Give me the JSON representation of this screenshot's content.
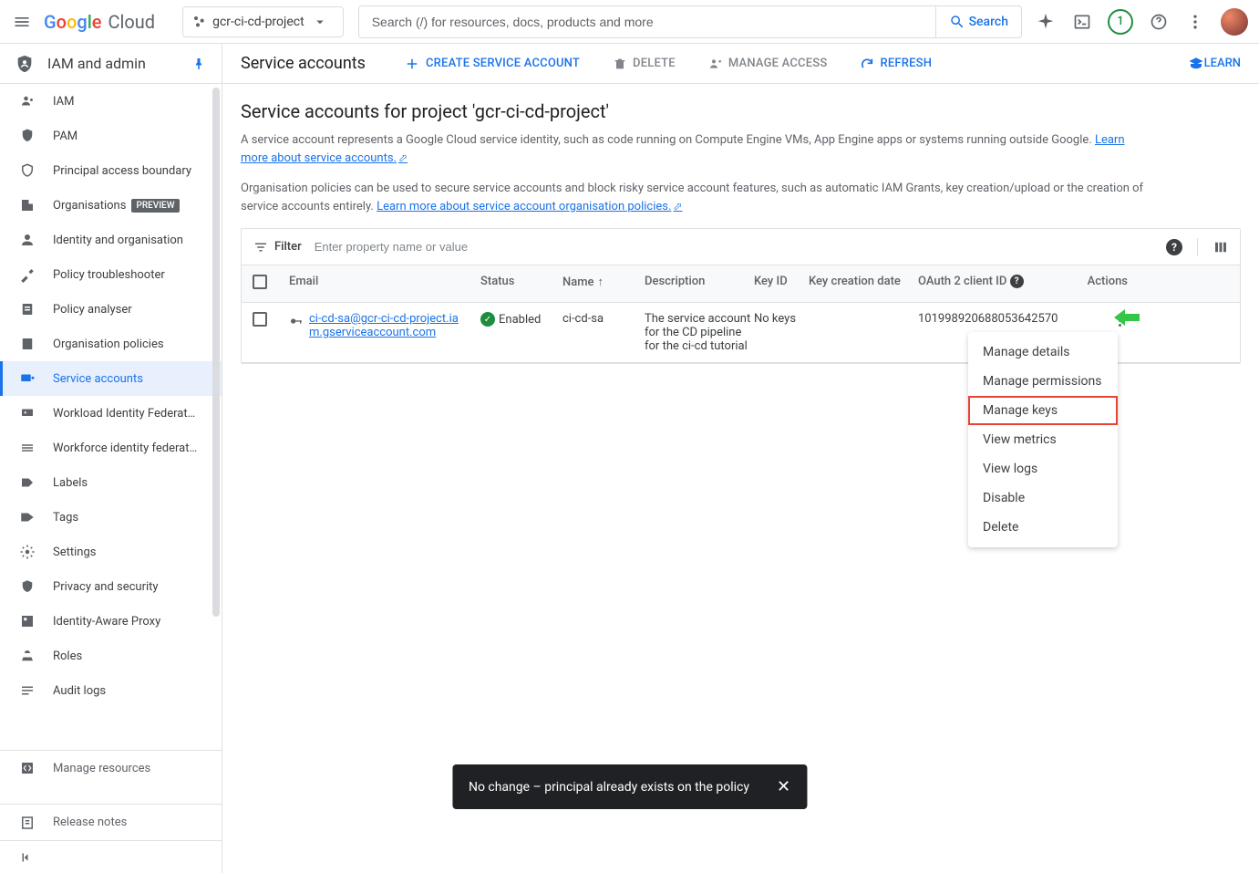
{
  "header": {
    "project_name": "gcr-ci-cd-project",
    "search_placeholder": "Search (/) for resources, docs, products and more",
    "search_button": "Search",
    "badge_count": "1"
  },
  "sidebar": {
    "section_title": "IAM and admin",
    "items": [
      {
        "label": "IAM"
      },
      {
        "label": "PAM"
      },
      {
        "label": "Principal access boundary"
      },
      {
        "label": "Organisations",
        "badge": "PREVIEW"
      },
      {
        "label": "Identity and organisation"
      },
      {
        "label": "Policy troubleshooter"
      },
      {
        "label": "Policy analyser"
      },
      {
        "label": "Organisation policies"
      },
      {
        "label": "Service accounts"
      },
      {
        "label": "Workload Identity Federat…"
      },
      {
        "label": "Workforce identity federat…"
      },
      {
        "label": "Labels"
      },
      {
        "label": "Tags"
      },
      {
        "label": "Settings"
      },
      {
        "label": "Privacy and security"
      },
      {
        "label": "Identity-Aware Proxy"
      },
      {
        "label": "Roles"
      },
      {
        "label": "Audit logs"
      }
    ],
    "bottom": {
      "label": "Manage resources"
    },
    "release_notes": "Release notes"
  },
  "page": {
    "title": "Service accounts",
    "actions": {
      "create": "Create service account",
      "delete": "Delete",
      "manage_access": "Manage access",
      "refresh": "Refresh",
      "learn": "Learn"
    },
    "heading": "Service accounts for project 'gcr-ci-cd-project'",
    "desc1a": "A service account represents a Google Cloud service identity, such as code running on Compute Engine VMs, App Engine apps or systems running outside Google. ",
    "desc1_link": "Learn more about service accounts.",
    "desc2a": "Organisation policies can be used to secure service accounts and block risky service account features, such as automatic IAM Grants, key creation/upload or the creation of service accounts entirely. ",
    "desc2_link": "Learn more about service account organisation policies."
  },
  "filter": {
    "label": "Filter",
    "placeholder": "Enter property name or value"
  },
  "table": {
    "headers": {
      "email": "Email",
      "status": "Status",
      "name": "Name",
      "description": "Description",
      "keyid": "Key ID",
      "keydate": "Key creation date",
      "oauth": "OAuth 2 client ID",
      "actions": "Actions"
    },
    "row": {
      "email": "ci-cd-sa@gcr-ci-cd-project.iam.gserviceaccount.com",
      "status": "Enabled",
      "name": "ci-cd-sa",
      "description": "The service account for the CD pipeline for the ci-cd tutorial",
      "keyid": "No keys",
      "keydate": "",
      "oauth": "101998920688053642570"
    }
  },
  "dropdown": {
    "items": [
      "Manage details",
      "Manage permissions",
      "Manage keys",
      "View metrics",
      "View logs",
      "Disable",
      "Delete"
    ]
  },
  "toast": {
    "message": "No change – principal already exists on the policy"
  }
}
